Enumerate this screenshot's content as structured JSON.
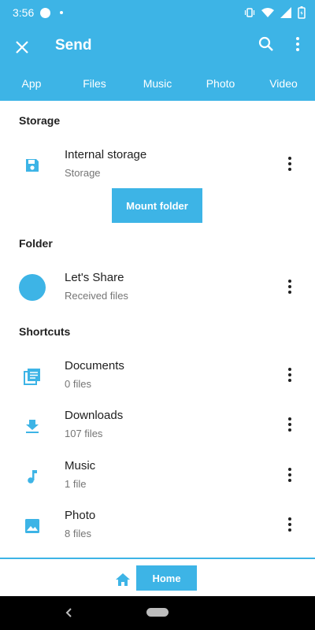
{
  "status": {
    "time": "3:56"
  },
  "appbar": {
    "title": "Send"
  },
  "tabs": [
    "App",
    "Files",
    "Music",
    "Photo",
    "Video"
  ],
  "sections": {
    "storage": "Storage",
    "folder": "Folder",
    "shortcuts": "Shortcuts"
  },
  "storage_item": {
    "primary": "Internal storage",
    "secondary": "Storage"
  },
  "mount_button": "Mount folder",
  "folder_item": {
    "primary": "Let's Share",
    "secondary": "Received files"
  },
  "shortcuts": [
    {
      "primary": "Documents",
      "secondary": "0 files",
      "icon": "documents-icon"
    },
    {
      "primary": "Downloads",
      "secondary": "107 files",
      "icon": "download-icon"
    },
    {
      "primary": "Music",
      "secondary": "1 file",
      "icon": "music-note-icon"
    },
    {
      "primary": "Photo",
      "secondary": "8 files",
      "icon": "photo-icon"
    }
  ],
  "bottom": {
    "home_label": "Home"
  },
  "colors": {
    "accent": "#3db4e6"
  }
}
